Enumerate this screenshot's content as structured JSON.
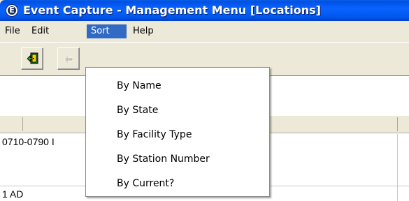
{
  "window": {
    "title": "Event Capture - Management Menu [Locations]",
    "app_icon_letter": "E"
  },
  "menubar": {
    "items": [
      {
        "label": "File"
      },
      {
        "label": "Edit"
      },
      {
        "label": "Sort",
        "active": true
      },
      {
        "label": "Help"
      }
    ]
  },
  "toolbar": {
    "buttons": [
      {
        "icon": "exit-icon",
        "enabled": true
      },
      {
        "icon": "move-icon",
        "enabled": false
      }
    ]
  },
  "grid": {
    "rows": [
      {
        "text": "0710-0790 I"
      },
      {
        "text": "1 AD"
      }
    ]
  },
  "sort_menu": {
    "items": [
      {
        "label": "By Name"
      },
      {
        "label": "By State"
      },
      {
        "label": "By Facility Type"
      },
      {
        "label": "By Station Number"
      },
      {
        "label": "By Current?"
      }
    ]
  }
}
